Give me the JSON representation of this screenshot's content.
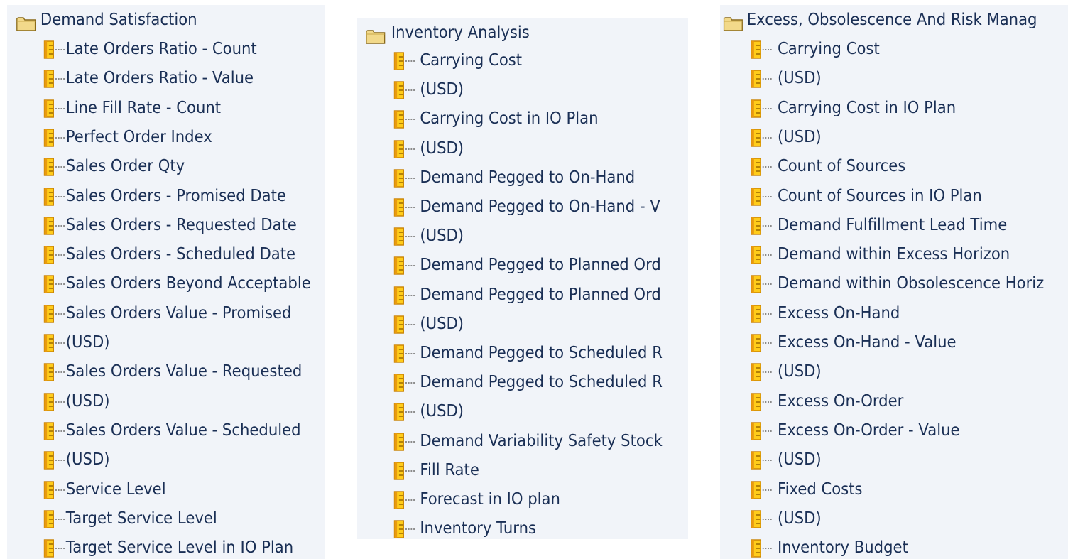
{
  "panels": [
    {
      "folder": "Demand Satisfaction",
      "items": [
        "Late Orders Ratio - Count",
        "Late Orders Ratio - Value",
        "Line Fill Rate - Count",
        "Perfect Order Index",
        "Sales Order Qty",
        "Sales Orders - Promised Date",
        "Sales Orders - Requested Date",
        "Sales Orders - Scheduled Date",
        "Sales Orders Beyond Acceptable",
        "Sales Orders Value - Promised",
        "(USD)",
        "Sales Orders Value - Requested",
        "(USD)",
        "Sales Orders Value - Scheduled",
        "(USD)",
        "Service Level",
        "Target Service Level",
        "Target Service Level in IO Plan"
      ]
    },
    {
      "folder": "Inventory Analysis",
      "items": [
        "Carrying Cost",
        "(USD)",
        "Carrying Cost in IO Plan",
        "(USD)",
        "Demand Pegged to On-Hand",
        "Demand Pegged to On-Hand - V",
        "(USD)",
        "Demand Pegged to Planned Ord",
        "Demand Pegged to Planned Ord",
        "(USD)",
        "Demand Pegged to Scheduled R",
        "Demand Pegged to Scheduled R",
        "(USD)",
        "Demand Variability Safety Stock",
        "Fill Rate",
        "Forecast in IO plan",
        "Inventory Turns"
      ]
    },
    {
      "folder": "Excess, Obsolescence And Risk Manag",
      "items": [
        "Carrying Cost",
        "(USD)",
        "Carrying Cost in IO Plan",
        "(USD)",
        "Count of Sources",
        "Count of Sources in IO Plan",
        "Demand Fulfillment Lead Time",
        "Demand within Excess Horizon",
        "Demand within Obsolescence Horiz",
        "Excess On-Hand",
        "Excess On-Hand - Value",
        "(USD)",
        "Excess On-Order",
        "Excess On-Order - Value",
        "(USD)",
        "Fixed Costs",
        "(USD)",
        "Inventory Budget"
      ]
    }
  ],
  "colors": {
    "panel_bg": "#f1f4f9",
    "text": "#1a2f55",
    "icon_yellow": "#ffcc1a",
    "icon_orange": "#d08a00",
    "folder_fill": "#f2d98a"
  }
}
